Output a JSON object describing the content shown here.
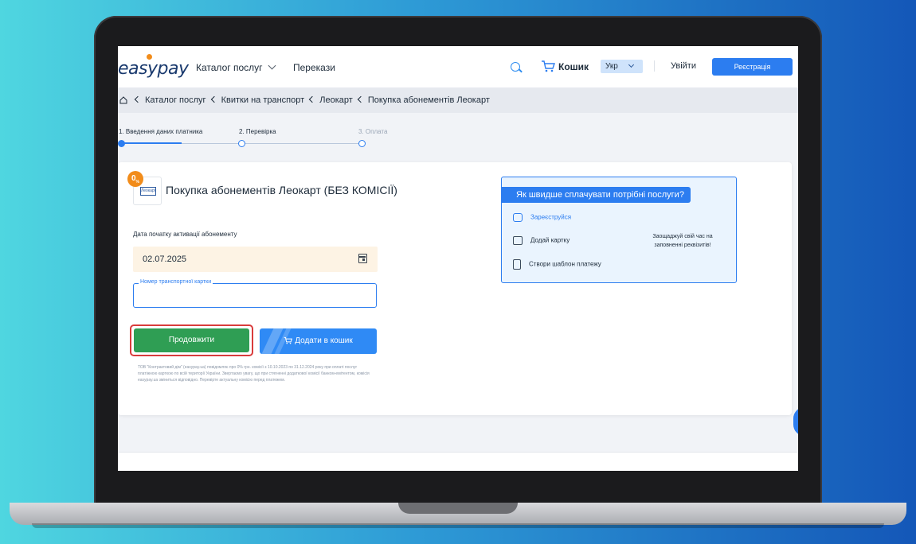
{
  "header": {
    "logo": "easypay",
    "nav": [
      "Каталог послуг",
      "Перекази"
    ],
    "cart_label": "Кошик",
    "language": "Укр",
    "login_label": "Увійти",
    "register_label": "Реєстрація"
  },
  "breadcrumb": [
    "Каталог послуг",
    "Квитки на транспорт",
    "Леокарт",
    "Покупка абонементів Леокарт"
  ],
  "steps": [
    {
      "label": "1. Введення даних платника",
      "state": "active"
    },
    {
      "label": "2. Перевірка",
      "state": "pending"
    },
    {
      "label": "3. Оплата",
      "state": "pending"
    }
  ],
  "service": {
    "badge": "0",
    "badge_suffix": "%",
    "logo_text": "Леокарт",
    "title": "Покупка абонементів Леокарт (БЕЗ КОМІСІЇ)"
  },
  "form": {
    "date_label": "Дата початку активації абонементу",
    "date_value": "02.07.2025",
    "card_label": "Номер транспортної картки",
    "card_value": ""
  },
  "buttons": {
    "continue_label": "Продовжити",
    "add_to_cart_label": "Додати в кошик"
  },
  "disclaimer": "ТОВ \"Контрактовий дім\" (easypay.ua) повідомляє про 0% грн. комісії з 10.10.2023 по 31.12.2024 року при оплаті послуг платіжною карткою по всій території України. Звертаємо увагу, що при стягненні додаткової комісії банком-емітентом, комісія easypay.ua зміниться відповідно. Перевірте актуальну комісію перед платежем.",
  "info_box": {
    "title": "Як швидше сплачувати потрібні послуги?",
    "items": [
      "Зареєструйся",
      "Додай картку",
      "Створи шаблон платежу"
    ],
    "note": "Заощаджуй свій час на заповненні реквізитів!"
  },
  "colors": {
    "primary_blue": "#2c7df0",
    "continue_green": "#2f9e54",
    "badge_orange": "#f28c1a",
    "highlight_red": "#d93b3b"
  }
}
